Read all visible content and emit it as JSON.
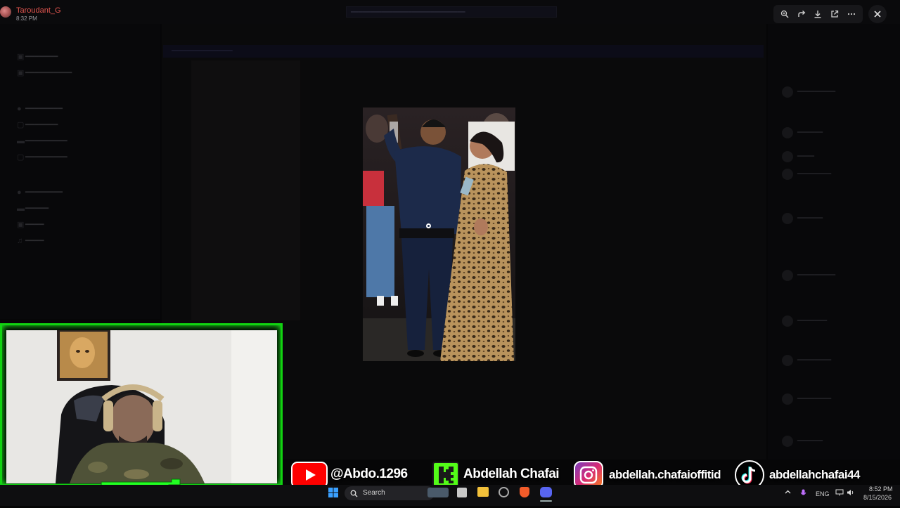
{
  "viewer": {
    "uploader_name": "Taroudant_G",
    "upload_time": "8:32 PM",
    "tool_icons": [
      "zoom-icon",
      "forward-icon",
      "download-icon",
      "open-external-icon",
      "more-icon"
    ],
    "close_icon": "close-icon"
  },
  "socials": {
    "youtube_handle": "@Abdo.1296",
    "kick_handle": "Abdellah Chafai",
    "instagram_handle": "abdellah.chafaioffitid",
    "tiktok_handle": "abdellahchafai44",
    "colors": {
      "youtube": "#ff0000",
      "kick": "#53fc18",
      "instagram": "#d62976",
      "tiktok": "#000000"
    }
  },
  "taskbar": {
    "search_placeholder": "Search",
    "language": "ENG",
    "time": "8:52 PM",
    "date": "8/15/2026"
  },
  "accent": {
    "webcam_frame": "#11d411"
  }
}
